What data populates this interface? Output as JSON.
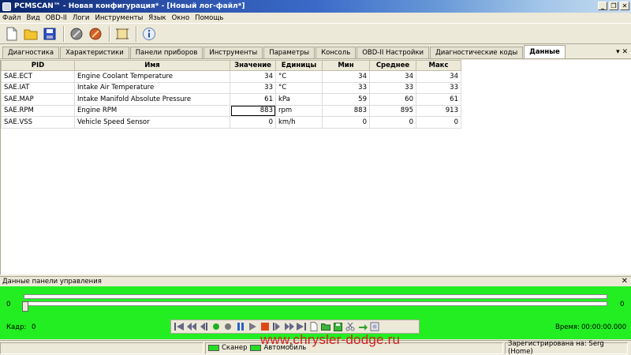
{
  "window": {
    "title": "PCMSCAN™ - Новая конфигурация* - [Новый лог-файл*]"
  },
  "menu": [
    "Файл",
    "Вид",
    "OBD-II",
    "Логи",
    "Инструменты",
    "Язык",
    "Окно",
    "Помощь"
  ],
  "toolbar": {
    "icons": [
      "new-file-icon",
      "open-folder-icon",
      "save-disk-icon",
      "connect-plug-icon",
      "disconnect-plug-icon",
      "frame-icon",
      "info-icon"
    ]
  },
  "tabs": [
    {
      "label": "Диагностика"
    },
    {
      "label": "Характеристики"
    },
    {
      "label": "Панели приборов"
    },
    {
      "label": "Инструменты"
    },
    {
      "label": "Параметры"
    },
    {
      "label": "Консоль"
    },
    {
      "label": "OBD-II Настройки"
    },
    {
      "label": "Диагностические коды"
    },
    {
      "label": "Данные"
    }
  ],
  "active_tab": "Данные",
  "table": {
    "headers": [
      "PID",
      "Имя",
      "Значение",
      "Единицы",
      "Мин",
      "Среднее",
      "Макс"
    ],
    "rows": [
      [
        "SAE.ECT",
        "Engine Coolant Temperature",
        "34",
        "°C",
        "34",
        "34",
        "34"
      ],
      [
        "SAE.IAT",
        "Intake Air Temperature",
        "33",
        "°C",
        "33",
        "33",
        "33"
      ],
      [
        "SAE.MAP",
        "Intake Manifold Absolute Pressure",
        "61",
        "kPa",
        "59",
        "60",
        "61"
      ],
      [
        "SAE.RPM",
        "Engine RPM",
        "883",
        "rpm",
        "883",
        "895",
        "913"
      ],
      [
        "SAE.VSS",
        "Vehicle Speed Sensor",
        "0",
        "km/h",
        "0",
        "0",
        "0"
      ]
    ]
  },
  "control_panel": {
    "title": "Данные панели управления",
    "slider_min": "0",
    "slider_max": "0",
    "frame_label": "Кадр:",
    "frame_value": "0",
    "time_label": "Время:",
    "time_value": "00:00:00.000",
    "accent_color": "#22ee22"
  },
  "statusbar": {
    "scanner": "Сканер",
    "vehicle": "Автомобиль",
    "registered": "Зарегистрирована на: Serg (Home)"
  },
  "watermark": "www.chrysler-dodge.ru"
}
